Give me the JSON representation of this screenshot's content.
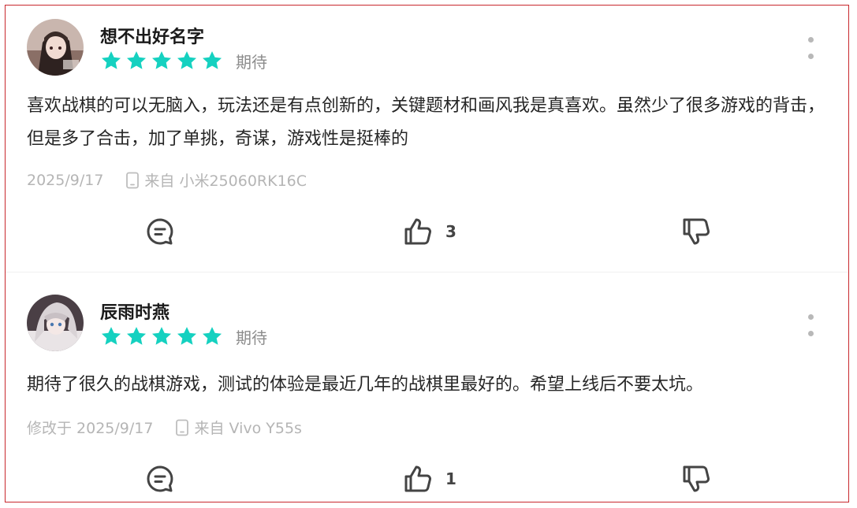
{
  "reviews": [
    {
      "username": "想不出好名字",
      "rating": 5,
      "tag": "期待",
      "content": "喜欢战棋的可以无脑入，玩法还是有点创新的，关键题材和画风我是真喜欢。虽然少了很多游戏的背击，但是多了合击，加了单挑，奇谋，游戏性是挺棒的",
      "date": "2025/9/17",
      "device": "来自 小米25060RK16C",
      "likes": "3"
    },
    {
      "username": "辰雨时燕",
      "rating": 5,
      "tag": "期待",
      "content": "期待了很久的战棋游戏，测试的体验是最近几年的战棋里最好的。希望上线后不要太坑。",
      "date": "修改于 2025/9/17",
      "device": "来自 Vivo Y55s",
      "likes": "1"
    }
  ],
  "icons": {
    "star": "star-icon",
    "more": "more-vertical-icon",
    "device": "phone-icon",
    "comment": "comment-icon",
    "like": "thumbs-up-icon",
    "dislike": "thumbs-down-icon"
  },
  "colors": {
    "star": "#15d1c0",
    "border": "#c8282d",
    "meta_text": "#b5b5b5",
    "icon": "#444444"
  }
}
